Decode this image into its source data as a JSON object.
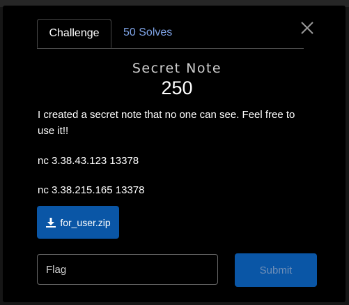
{
  "modal": {
    "tabs": [
      {
        "label": "Challenge",
        "active": true
      },
      {
        "label": "50 Solves",
        "active": false
      }
    ],
    "close_icon": "close-icon",
    "challenge": {
      "name": "Secret Note",
      "points": "250",
      "description": [
        "I created a secret note that no one can see. Feel free to use it!!",
        "nc 3.38.43.123 13378",
        "nc 3.38.215.165 13378"
      ],
      "file_label": "for_user.zip",
      "file_icon": "download-icon"
    },
    "flag_input": {
      "value": "",
      "placeholder": "Flag"
    },
    "submit_label": "Submit"
  },
  "colors": {
    "background": "#000000",
    "accent": "#0a56a6",
    "tab_link": "#7ea3e6"
  }
}
